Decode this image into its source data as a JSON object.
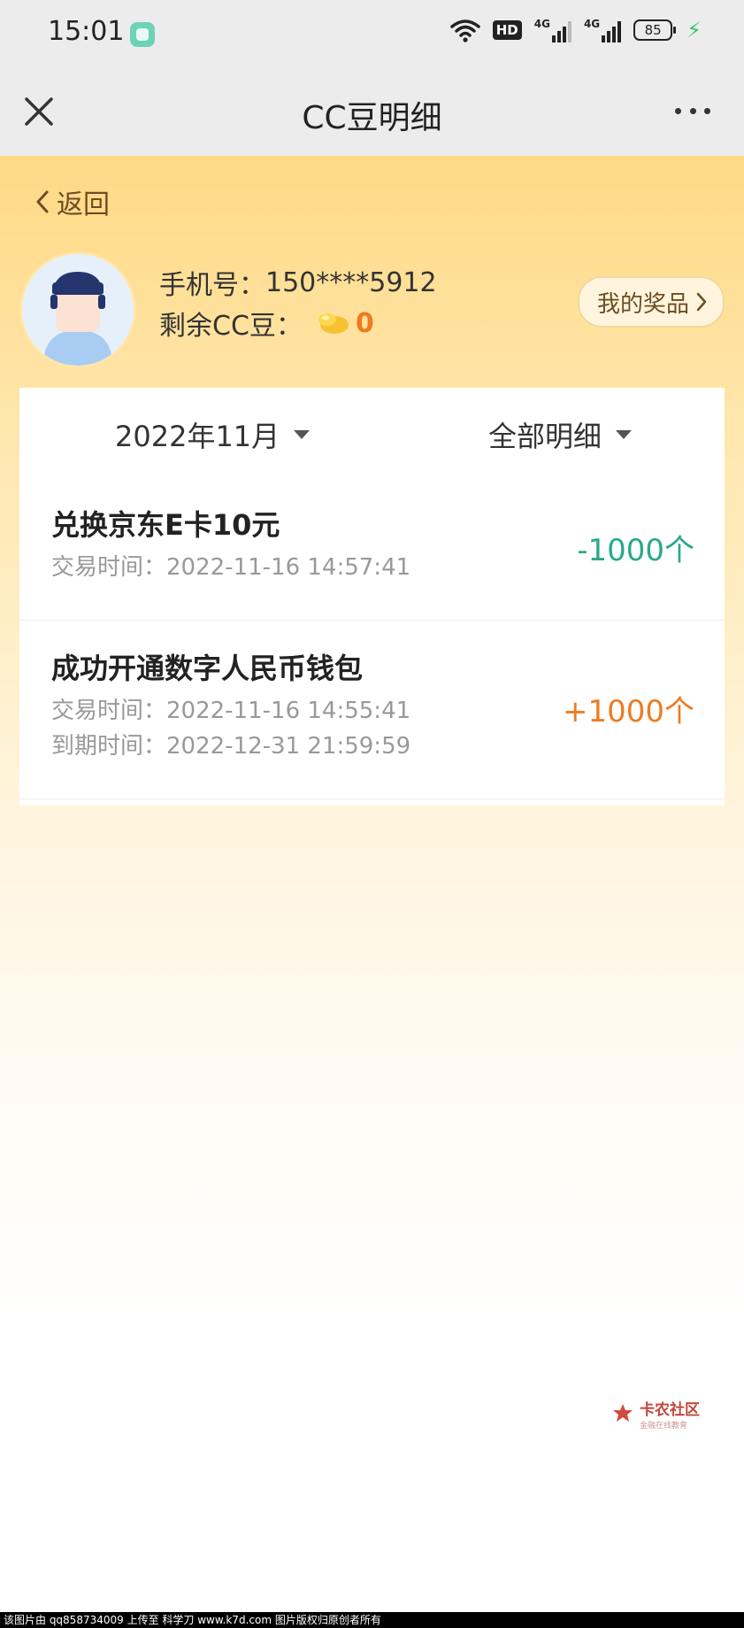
{
  "status_bar": {
    "time": "15:01",
    "hd_label": "HD",
    "net1_label": "4G",
    "net2_label": "4G",
    "battery": "85"
  },
  "nav": {
    "title": "CC豆明细"
  },
  "back": {
    "label": "返回"
  },
  "user": {
    "phone_label": "手机号：",
    "phone_value": "150****5912",
    "beans_label": "剩余CC豆：",
    "beans_value": "0",
    "prize_button": "我的奖品"
  },
  "filters": {
    "month": "2022年11月",
    "type": "全部明细"
  },
  "transactions": [
    {
      "title": "兑换京东E卡10元",
      "trade_time_label": "交易时间：",
      "trade_time": "2022-11-16 14:57:41",
      "amount": "-1000个",
      "direction": "minus"
    },
    {
      "title": "成功开通数字人民币钱包",
      "trade_time_label": "交易时间：",
      "trade_time": "2022-11-16 14:55:41",
      "expire_time_label": "到期时间：",
      "expire_time": "2022-12-31 21:59:59",
      "amount": "+1000个",
      "direction": "plus"
    }
  ],
  "watermark": {
    "name": "卡农社区",
    "sub": "金融在线教育"
  },
  "footer": {
    "text": "该图片由 qq858734009 上传至 科学刀 www.k7d.com 图片版权归原创者所有"
  },
  "colors": {
    "minus": "#2aa98a",
    "plus": "#ee7b22",
    "accent_brown": "#6e4d22"
  }
}
